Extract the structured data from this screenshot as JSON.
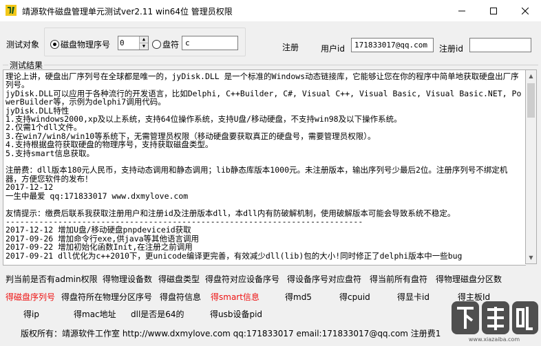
{
  "window": {
    "title": "靖源软件磁盘管理单元测试ver2.11 win64位 管理员权限"
  },
  "controls": {
    "test_object_label": "测试对象",
    "radio_physical_label": "磁盘物理序号",
    "physical_index_value": "0",
    "radio_drive_label": "盘符",
    "drive_value": "c",
    "register_label": "注册",
    "user_id_label": "用户id",
    "user_id_value": "171833017@qq.com",
    "register_id_label": "注册id",
    "register_id_value": ""
  },
  "result": {
    "group_label": "测试结果",
    "text": "理论上讲，硬盘出厂序列号在全球都是唯一的，jyDisk.DLL 是一个标准的Windows动态链接库，它能够让您在你的程序中简单地获取硬盘出厂序列号。\njyDisk.DLL可以应用于各种流行的开发语言，比如Delphi, C++Builder, C#, Visual C++, Visual Basic, Visual Basic.NET, PowerBuilder等，示例为delphi7调用代码。\njyDisk.DLL特性\n1.支持windows2000,xp及以上系统，支持64位操作系统，支持U盘/移动硬盘，不支持win98及以下操作系统。\n2.仅需1个dll文件。\n3.在win7/win8/win10等系统下，无需管理员权限（移动硬盘要获取真正的硬盘号，需要管理员权限）。\n4.支持根据盘符获取硬盘的物理序号，支持获取磁盘类型。\n5.支持smart信息获取。\n\n注册费：dll版本180元人民币，支持动态调用和静态调用；lib静态库版本1000元。未注册版本，输出序列号少最后2位。注册序列号不绑定机器，方便您软件的发布！\n2017-12-12\n一生中最爱 qq:171833017 www.dxmylove.com\n\n友情提示：缴费后联系我获取注册用户和注册id及注册版本dll，本dll内有防破解机制，使用破解版本可能会导致系统不稳定。\n---------------------------------------------------------------------------\n2017-12-12 增加U盘/移动硬盘pnpdeviceid获取\n2017-09-26 增加命令行exe,供java等其他语言调用\n2017-09-22 增加初始化函数Init,在注册之前调用\n2017-09-21 dll优化为c++2010下，更unicode编译更完善，有效减少dll(lib)包的大小!同时修正了delphi版本中一些bug"
  },
  "actions": {
    "row1": [
      "判当前是否有admin权限",
      "得物理设备数",
      "得磁盘类型",
      "得盘符对应设备序号",
      "得设备序号对应盘符",
      "得当前所有盘符",
      "得物理磁盘分区数"
    ],
    "row2": [
      "得磁盘序列号",
      "得盘符所在物理分区序号",
      "得盘符信息",
      "得smart信息",
      "得md5",
      "得cpuid",
      "得显卡id",
      "得主板Id"
    ],
    "row3": [
      "得ip",
      "得mac地址",
      "dll是否是64的",
      "得usb设备pid"
    ]
  },
  "footer": {
    "text": "版权所有：靖源软件工作室 http://www.dxmylove.com qq:171833017 email:171833017@qq.com 注册费1"
  },
  "watermark": {
    "text": "下载吧"
  },
  "colors": {
    "link_red": "#e11111",
    "window_bg": "#f0f0f0"
  }
}
